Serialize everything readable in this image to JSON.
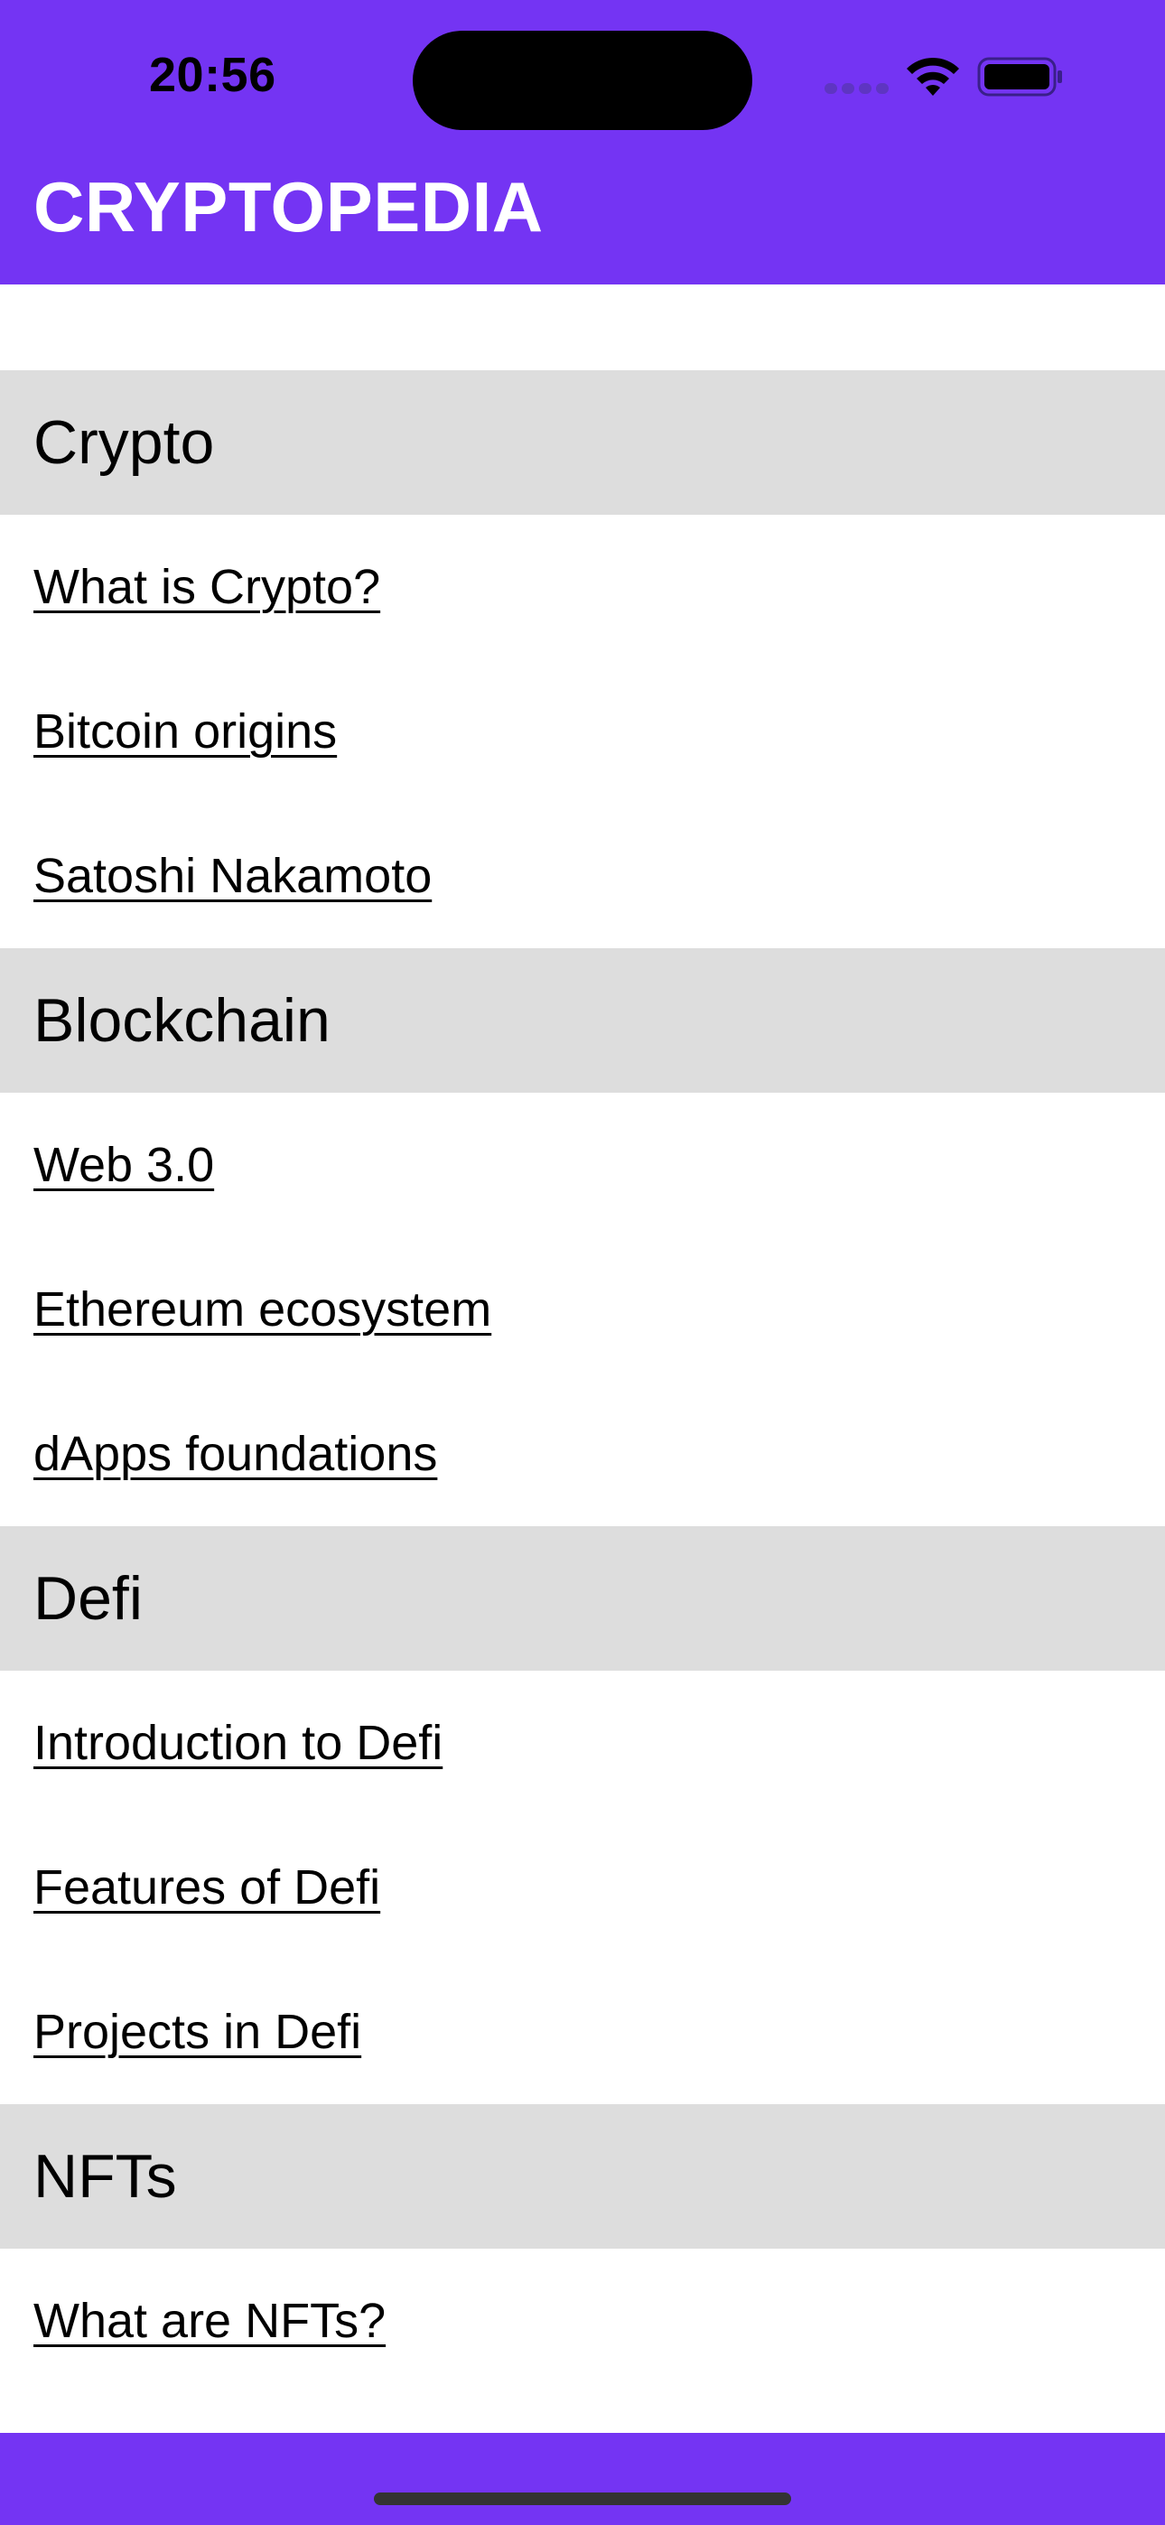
{
  "status_bar": {
    "time": "20:56"
  },
  "header": {
    "title": "CRYPTOPEDIA"
  },
  "colors": {
    "brand": "#7434f3",
    "section_header_bg": "#dddddd"
  },
  "sections": [
    {
      "title": "Crypto",
      "items": [
        "What is Crypto?",
        "Bitcoin origins",
        "Satoshi Nakamoto"
      ]
    },
    {
      "title": "Blockchain",
      "items": [
        "Web 3.0",
        "Ethereum ecosystem",
        "dApps foundations"
      ]
    },
    {
      "title": "Defi",
      "items": [
        "Introduction to Defi",
        "Features of Defi",
        "Projects in Defi"
      ]
    },
    {
      "title": "NFTs",
      "items": [
        "What are NFTs?"
      ]
    }
  ],
  "icons": {
    "wifi": "wifi-icon",
    "battery": "battery-icon",
    "cellular": "cellular-signal-icon"
  }
}
